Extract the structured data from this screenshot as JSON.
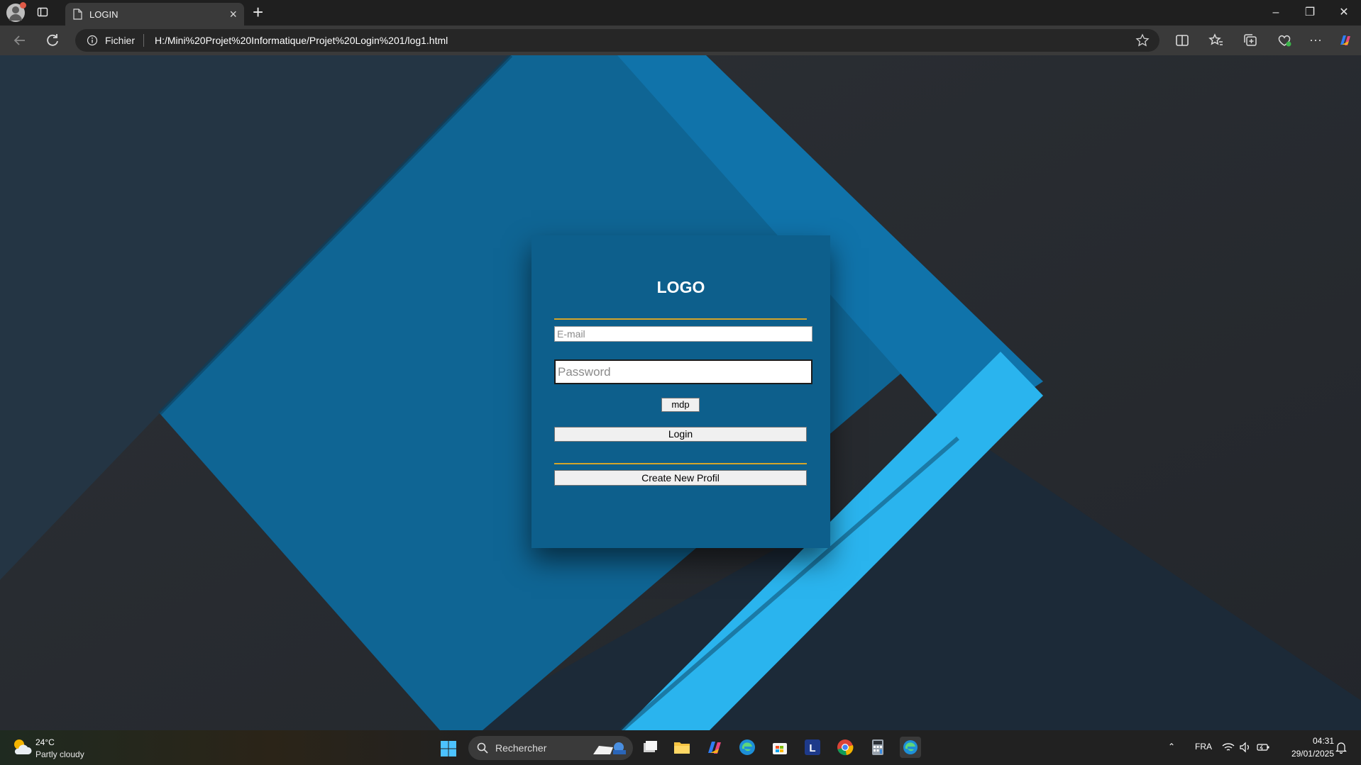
{
  "browser": {
    "tab_title": "LOGIN",
    "url_scheme": "Fichier",
    "url": "H:/Mini%20Projet%20Informatique/Projet%20Login%201/log1.html"
  },
  "page": {
    "logo": "LOGO",
    "email_placeholder": "E-mail",
    "password_placeholder": "Password",
    "mdp_label": "mdp",
    "login_label": "Login",
    "create_label": "Create New Profil"
  },
  "taskbar": {
    "weather_temp": "24°C",
    "weather_condition": "Partly cloudy",
    "search_label": "Rechercher",
    "language": "FRA",
    "time": "04:31",
    "date": "29/01/2025"
  },
  "colors": {
    "card": "#0d5f8c",
    "accent_line": "#d4a52a",
    "stripe": "#2ab4ee"
  }
}
